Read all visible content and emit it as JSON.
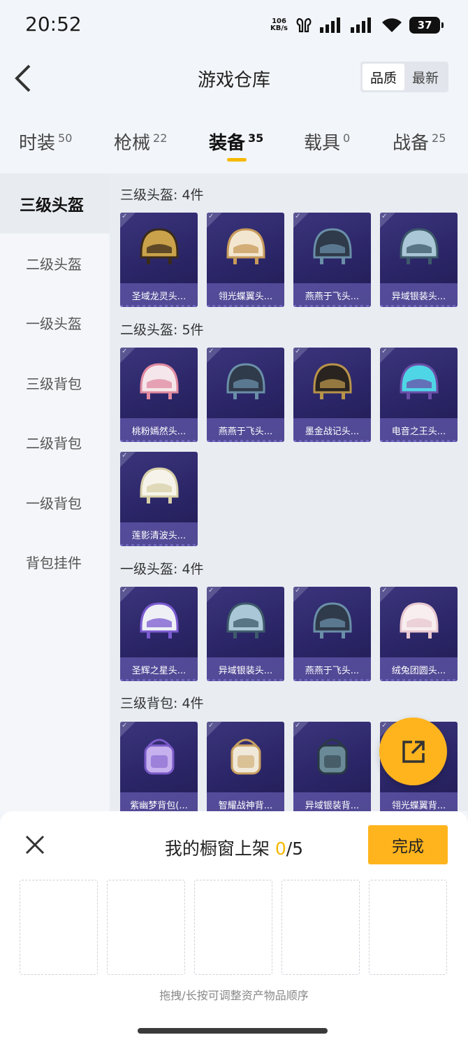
{
  "status_bar": {
    "time": "20:52",
    "net_speed_value": "106",
    "net_speed_unit": "KB/s",
    "battery": "37"
  },
  "header": {
    "title": "游戏仓库",
    "sort_options": [
      "品质",
      "最新"
    ],
    "sort_selected": "品质"
  },
  "tabs": [
    {
      "label": "时装",
      "count": "50"
    },
    {
      "label": "枪械",
      "count": "22"
    },
    {
      "label": "装备",
      "count": "35",
      "active": true
    },
    {
      "label": "载具",
      "count": "0"
    },
    {
      "label": "战备",
      "count": "25"
    }
  ],
  "sidebar": {
    "items": [
      "三级头盔",
      "二级头盔",
      "一级头盔",
      "三级背包",
      "二级背包",
      "一级背包",
      "背包挂件"
    ],
    "active": "三级头盔"
  },
  "sections": [
    {
      "title": "三级头盔: 4件",
      "items": [
        {
          "name": "圣域龙灵头...",
          "icon": "gold-dragon-helmet"
        },
        {
          "name": "翎光蝶翼头...",
          "icon": "white-gold-butterfly-helmet"
        },
        {
          "name": "燕燕于飞头...",
          "icon": "dark-swallow-helmet"
        },
        {
          "name": "异域银装头...",
          "icon": "silver-exotic-helmet"
        }
      ]
    },
    {
      "title": "二级头盔: 5件",
      "items": [
        {
          "name": "桃粉嫣然头...",
          "icon": "pink-peach-helmet"
        },
        {
          "name": "燕燕于飞头...",
          "icon": "dark-swallow-helmet"
        },
        {
          "name": "墨金战记头...",
          "icon": "black-gold-helmet"
        },
        {
          "name": "电音之王头...",
          "icon": "cyan-dj-helmet"
        },
        {
          "name": "莲影清波头...",
          "icon": "white-lotus-helmet"
        }
      ]
    },
    {
      "title": "一级头盔: 4件",
      "items": [
        {
          "name": "圣辉之星头...",
          "icon": "white-purple-star-helmet"
        },
        {
          "name": "异域银装头...",
          "icon": "silver-exotic-helmet"
        },
        {
          "name": "燕燕于飞头...",
          "icon": "dark-swallow-helmet"
        },
        {
          "name": "绒兔团圆头...",
          "icon": "pink-bunny-helmet"
        }
      ]
    },
    {
      "title": "三级背包: 4件",
      "items": [
        {
          "name": "紫幽梦背包(...",
          "icon": "purple-dream-backpack"
        },
        {
          "name": "智耀战神背...",
          "icon": "white-gold-backpack"
        },
        {
          "name": "异域银装背...",
          "icon": "silver-exotic-backpack"
        },
        {
          "name": "翎光蝶翼背...",
          "icon": "butterfly-backpack"
        }
      ]
    }
  ],
  "bottom_sheet": {
    "title_prefix": "我的橱窗上架 ",
    "current": "0",
    "total": "/5",
    "done_label": "完成",
    "slots": 5,
    "hint": "拖拽/长按可调整资产物品顺序"
  },
  "colors": {
    "accent": "#ffb41d",
    "card_bg": "#2a2566",
    "name_bar": "#786ec8"
  }
}
